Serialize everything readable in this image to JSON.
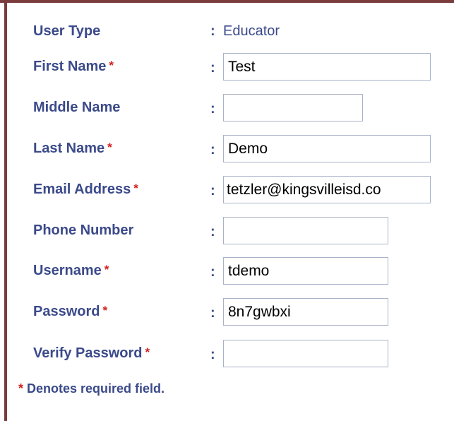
{
  "form": {
    "user_type": {
      "label": "User Type",
      "value": "Educator"
    },
    "first_name": {
      "label": "First Name",
      "required_mark": "*",
      "value": "Test"
    },
    "middle_name": {
      "label": "Middle Name",
      "value": ""
    },
    "last_name": {
      "label": "Last Name",
      "required_mark": "*",
      "value": "Demo"
    },
    "email": {
      "label": "Email Address",
      "required_mark": "*",
      "value": "tetzler@kingsvilleisd.co"
    },
    "phone": {
      "label": "Phone Number",
      "value": ""
    },
    "username": {
      "label": "Username",
      "required_mark": "*",
      "value": "tdemo"
    },
    "password": {
      "label": "Password",
      "required_mark": "*",
      "value": "8n7gwbxi"
    },
    "verify_password": {
      "label": "Verify Password",
      "required_mark": "*",
      "value": ""
    },
    "colon": ":",
    "note": {
      "mark": "*",
      "text": "Denotes required field."
    }
  },
  "colors": {
    "label": "#3b4a8a",
    "required": "#d42020",
    "border": "#7a3c3c",
    "field_border": "#a9b3c8"
  }
}
